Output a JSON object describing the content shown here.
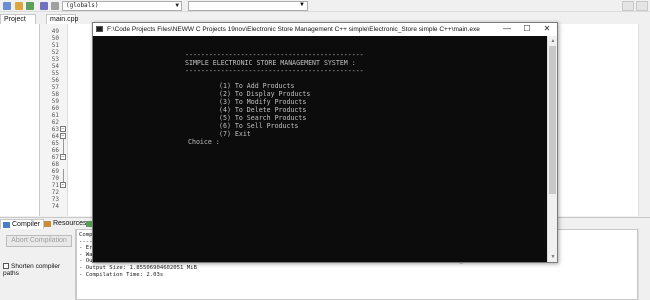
{
  "ide": {
    "scope_dropdown": "(globals)",
    "tabs": {
      "project": "Project",
      "file": "main.cpp"
    },
    "line_numbers": [
      "49",
      "50",
      "51",
      "52",
      "53",
      "54",
      "55",
      "56",
      "57",
      "58",
      "59",
      "60",
      "61",
      "62",
      "63",
      "64",
      "65",
      "66",
      "67",
      "68",
      "69",
      "70",
      "71",
      "72",
      "73",
      "74"
    ],
    "bottom_tabs": {
      "compiler": "Compiler",
      "resources": "Resources"
    },
    "abort_button": "Abort Compilation",
    "shorten_checkbox": "Shorten compiler paths",
    "log_lines": [
      "Comp",
      "----",
      "- Er",
      "- Wa",
      "- Output Filename: F:\\Code Projects Files\\NEWW C Projects 19nov\\Electronic Store Management C++ simple\\Electronic_Store simple C++\\main.exe",
      "- Output Size: 1.85506904602051 MiB",
      "- Compilation Time: 2.03s"
    ]
  },
  "console": {
    "title": "F:\\Code Projects Files\\NEWW C Projects 19nov\\Electronic Store Management C++ simple\\Electronic_Store simple C++\\main.exe",
    "separator": "---------------------------------------------",
    "heading": "SIMPLE ELECTRONIC STORE MANAGEMENT SYSTEM :",
    "menu": [
      "(1) To Add Products",
      "(2) To Display Products",
      "(3) To Modify Products",
      "(4) To Delete Products",
      "(5) To Search Products",
      "(6) To Sell Products",
      "(7) Exit"
    ],
    "prompt": "Choice :"
  },
  "colors": {
    "console_bg": "#0c0c0c",
    "console_text": "#c0c0c0"
  }
}
